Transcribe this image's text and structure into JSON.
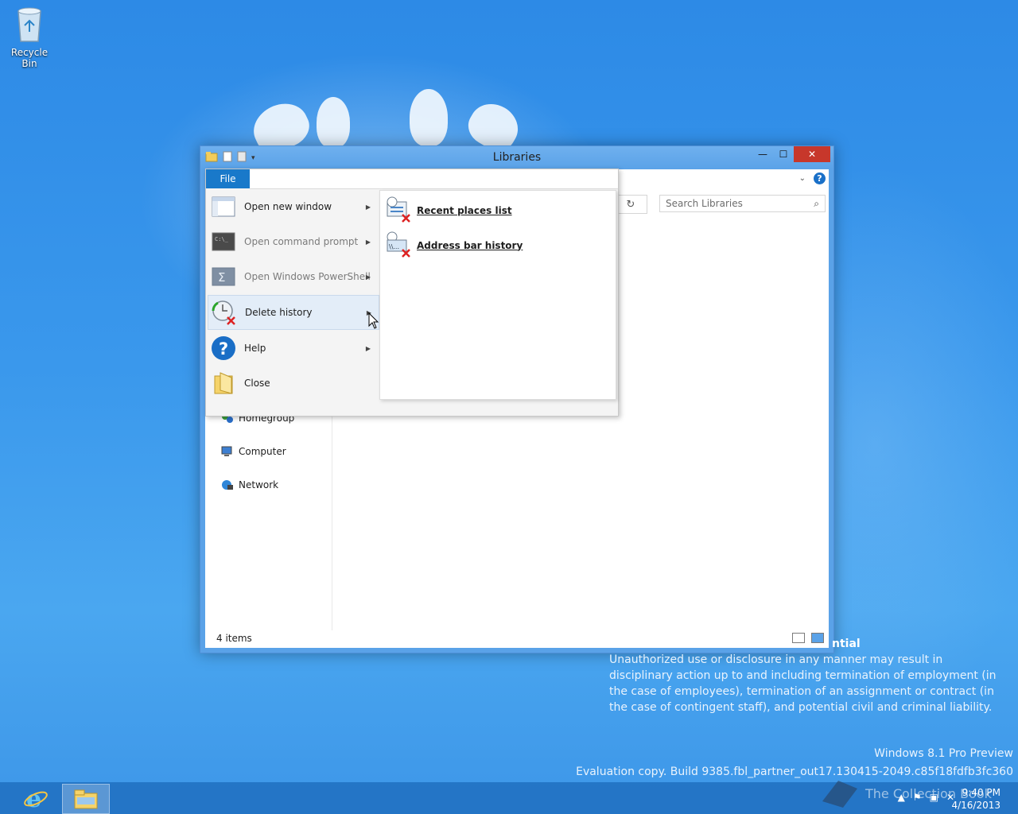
{
  "desktop": {
    "recycle_bin_label": "Recycle Bin"
  },
  "window": {
    "title": "Libraries",
    "close_glyph": "✕",
    "minimize_glyph": "—",
    "maximize_glyph": "☐",
    "search_placeholder": "Search Libraries",
    "status_count": "4 items",
    "nav_items": [
      {
        "label": "Homegroup",
        "icon": "homegroup-icon"
      },
      {
        "label": "Computer",
        "icon": "computer-icon"
      },
      {
        "label": "Network",
        "icon": "network-icon"
      }
    ]
  },
  "file_menu": {
    "tab_label": "File",
    "items": [
      {
        "label": "Open new window",
        "icon": "window-icon",
        "enabled": true
      },
      {
        "label": "Open command prompt",
        "icon": "command-prompt-icon",
        "enabled": false
      },
      {
        "label": "Open Windows PowerShell",
        "icon": "powershell-icon",
        "enabled": false
      },
      {
        "label": "Delete history",
        "icon": "delete-history-icon",
        "enabled": true
      },
      {
        "label": "Help",
        "icon": "help-icon",
        "enabled": true
      },
      {
        "label": "Close",
        "icon": "close-folder-icon",
        "enabled": true
      }
    ],
    "submenu": [
      {
        "label": "Recent places list",
        "icon": "recent-places-delete-icon"
      },
      {
        "label": "Address bar history",
        "icon": "address-history-delete-icon"
      }
    ]
  },
  "notice": {
    "heading_fragment": "ntial",
    "body": "Unauthorized use or disclosure in any manner may result in disciplinary action up to and including termination of employment (in the case of employees), termination of an assignment or contract (in the case of contingent staff), and potential civil and criminal liability."
  },
  "watermark": {
    "edition": "Windows 8.1 Pro Preview",
    "build": "Evaluation copy. Build 9385.fbl_partner_out17.130415-2049.c85f18fdfb3fc360",
    "collection": "The Collection Book"
  },
  "taskbar": {
    "time": "9:40 PM",
    "date": "4/16/2013"
  },
  "colors": {
    "accent": "#1979ca",
    "close": "#c7372b",
    "titlebar": "#5aa2e8"
  }
}
